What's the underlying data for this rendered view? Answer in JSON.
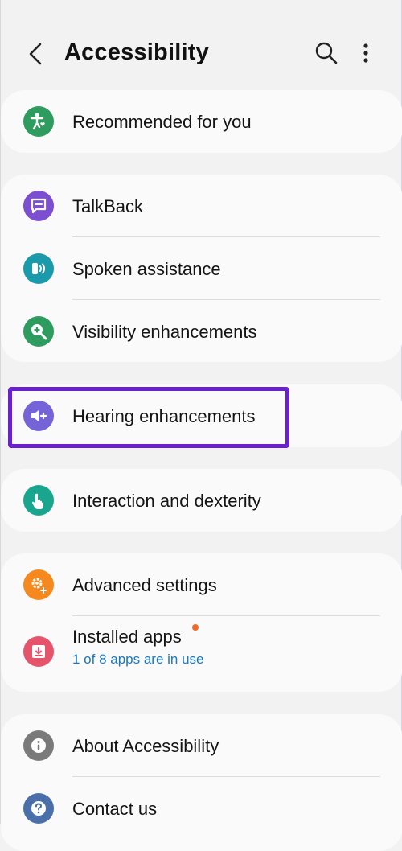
{
  "header": {
    "title": "Accessibility"
  },
  "items": {
    "recommended": {
      "label": "Recommended for you",
      "icon": "accessibility-heart-icon",
      "color": "#2e9b5f"
    },
    "talkback": {
      "label": "TalkBack",
      "icon": "chat-bubble-icon",
      "color": "#7c4fd0"
    },
    "spoken": {
      "label": "Spoken assistance",
      "icon": "sound-waves-icon",
      "color": "#1a9aaa"
    },
    "visibility": {
      "label": "Visibility enhancements",
      "icon": "magnifier-plus-icon",
      "color": "#2e9b5f"
    },
    "hearing": {
      "label": "Hearing enhancements",
      "icon": "speaker-plus-icon",
      "color": "#7563d8"
    },
    "interaction": {
      "label": "Interaction and dexterity",
      "icon": "touch-hand-icon",
      "color": "#1aa58f"
    },
    "advanced": {
      "label": "Advanced settings",
      "icon": "gears-plus-icon",
      "color": "#f5891f"
    },
    "installed": {
      "label": "Installed apps",
      "sub": "1 of 8 apps are in use",
      "icon": "download-tray-icon",
      "color": "#e6546c",
      "badge_color": "#f26a2a"
    },
    "about": {
      "label": "About Accessibility",
      "icon": "info-icon",
      "color": "#7a7a7a"
    },
    "contact": {
      "label": "Contact us",
      "icon": "question-icon",
      "color": "#4b6fa8"
    }
  },
  "highlight_color": "#6a1fd0"
}
